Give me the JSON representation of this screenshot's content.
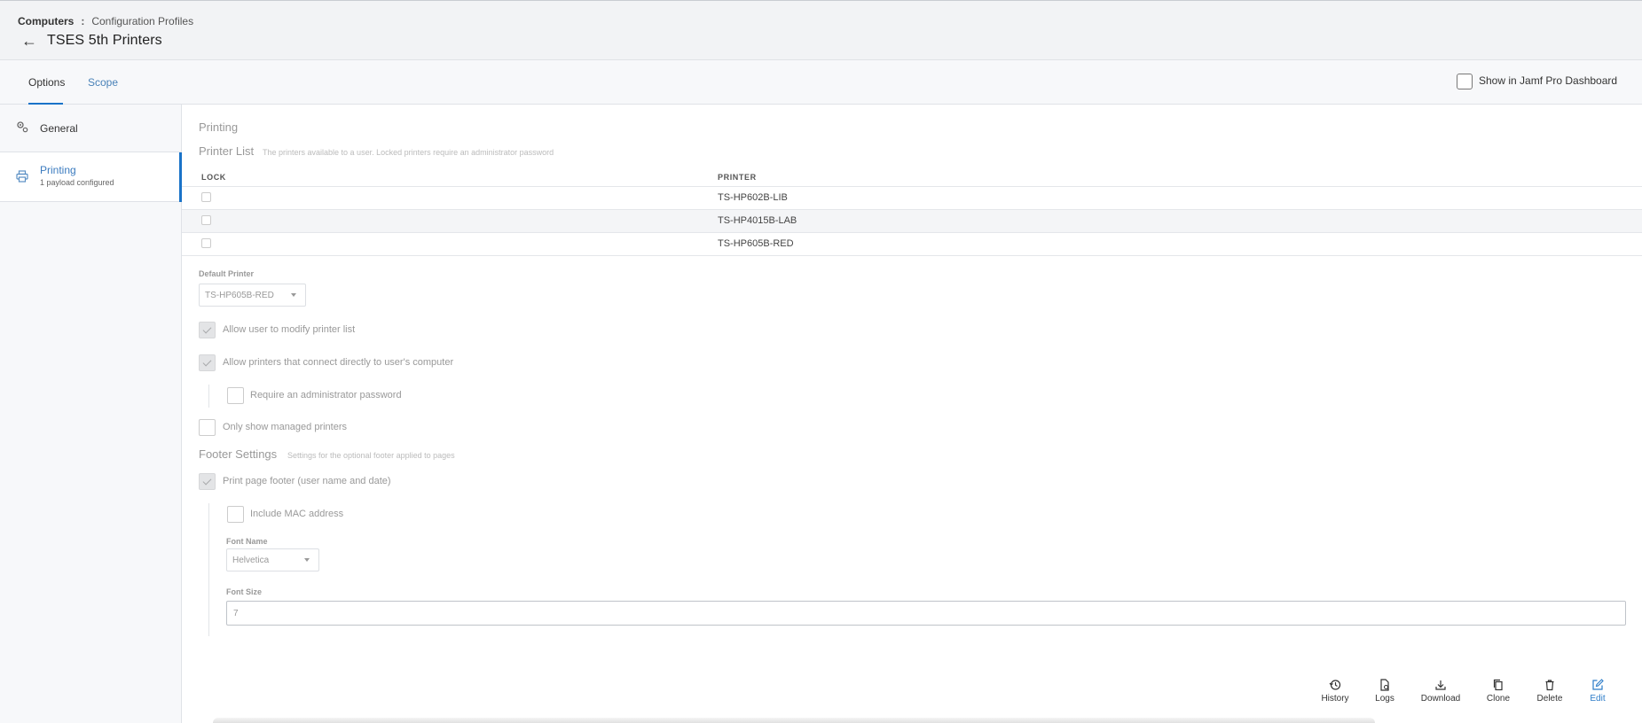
{
  "breadcrumb": {
    "root": "Computers",
    "separator": ":",
    "leaf": "Configuration Profiles"
  },
  "page": {
    "title": "TSES 5th Printers"
  },
  "tabs": [
    {
      "label": "Options",
      "active": true
    },
    {
      "label": "Scope",
      "active": false
    }
  ],
  "dashboard": {
    "label": "Show in Jamf Pro Dashboard",
    "checked": false
  },
  "sidebar": {
    "items": [
      {
        "label": "General",
        "icon": "gear-icon"
      },
      {
        "label": "Printing",
        "sub": "1 payload configured",
        "icon": "printer-icon",
        "active": true
      }
    ]
  },
  "printing": {
    "section_title": "Printing",
    "printer_list_title": "Printer List",
    "printer_list_desc": "The printers available to a user. Locked printers require an administrator password",
    "table": {
      "headers": [
        "LOCK",
        "PRINTER"
      ],
      "rows": [
        {
          "locked": false,
          "printer": "TS-HP602B-LIB"
        },
        {
          "locked": false,
          "printer": "TS-HP4015B-LAB"
        },
        {
          "locked": false,
          "printer": "TS-HP605B-RED"
        }
      ]
    },
    "default_printer_label": "Default Printer",
    "default_printer_value": "TS-HP605B-RED",
    "options": [
      {
        "label": "Allow user to modify printer list",
        "checked": true
      },
      {
        "label": "Allow printers that connect directly to user's computer",
        "checked": true
      },
      {
        "label": "Require an administrator password",
        "checked": false
      },
      {
        "label": "Only show managed printers",
        "checked": false
      }
    ]
  },
  "footer_settings": {
    "title": "Footer Settings",
    "desc": "Settings for the optional footer applied to pages",
    "print_footer": {
      "label": "Print page footer (user name and date)",
      "checked": true
    },
    "include_mac": {
      "label": "Include MAC address",
      "checked": false
    },
    "font_name_label": "Font Name",
    "font_name_value": "Helvetica",
    "font_size_label": "Font Size",
    "font_size_value": "7"
  },
  "actions": [
    {
      "label": "History",
      "icon": "history-icon"
    },
    {
      "label": "Logs",
      "icon": "logs-icon"
    },
    {
      "label": "Download",
      "icon": "download-icon"
    },
    {
      "label": "Clone",
      "icon": "clone-icon"
    },
    {
      "label": "Delete",
      "icon": "trash-icon"
    },
    {
      "label": "Edit",
      "icon": "edit-icon"
    }
  ],
  "colors": {
    "accent": "#1a73c8",
    "link": "#4a82b8",
    "muted_text": "#999999"
  }
}
